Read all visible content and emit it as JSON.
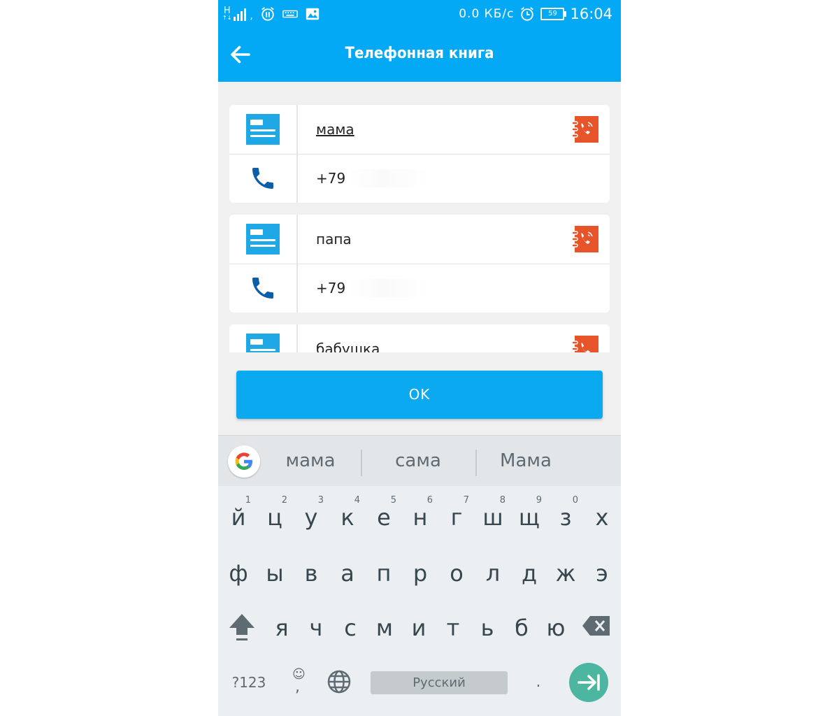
{
  "status_bar": {
    "network_type": "H",
    "speed": "0.0 КБ/с",
    "battery_level": "59",
    "time": "16:04"
  },
  "app_bar": {
    "title": "Телефонная книга"
  },
  "contacts": [
    {
      "name": "мама",
      "phone": "+79"
    },
    {
      "name": "папа",
      "phone": "+79"
    },
    {
      "name": "бабушка",
      "phone": ""
    }
  ],
  "ok_button": {
    "label": "OK"
  },
  "keyboard": {
    "suggestions": [
      "мама",
      "сама",
      "Мама"
    ],
    "row1": [
      "й",
      "ц",
      "у",
      "к",
      "е",
      "н",
      "г",
      "ш",
      "щ",
      "з",
      "х"
    ],
    "row1_hints": [
      "1",
      "2",
      "3",
      "4",
      "5",
      "6",
      "7",
      "8",
      "9",
      "0"
    ],
    "row2": [
      "ф",
      "ы",
      "в",
      "а",
      "п",
      "р",
      "о",
      "л",
      "д",
      "ж",
      "э"
    ],
    "row3": [
      "я",
      "ч",
      "с",
      "м",
      "и",
      "т",
      "ь",
      "б",
      "ю"
    ],
    "symbols_label": "?123",
    "space_label": "Русский",
    "period_label": ".",
    "emoji_comma": ","
  },
  "colors": {
    "primary": "#03a9f4",
    "card_icon": "#1fa8e6",
    "phone_icon": "#0d5ea8",
    "phonebook_icon": "#e8542a",
    "enter_key": "#4db6a0"
  }
}
